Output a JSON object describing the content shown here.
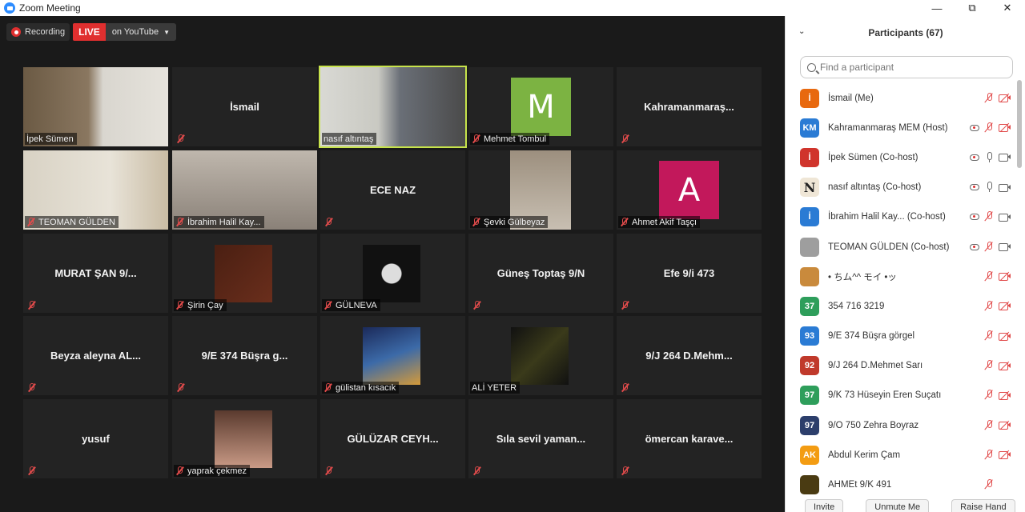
{
  "window": {
    "title": "Zoom Meeting",
    "controls": {
      "minimize": "—",
      "restore": "⧉",
      "close": "✕"
    }
  },
  "recording": {
    "recording_label": "Recording",
    "live_label": "LIVE",
    "stream_label": "on YouTube"
  },
  "tiles": [
    {
      "name": "İpek Sümen",
      "type": "video",
      "label": "İpek Sümen",
      "mic_muted": false
    },
    {
      "name": "İsmail",
      "type": "name",
      "label": "",
      "mic_muted": true
    },
    {
      "name": "nasıf altıntaş",
      "type": "video",
      "label": "nasıf altıntaş",
      "mic_muted": false,
      "speaking": true
    },
    {
      "name": "Mehmet Tombul",
      "type": "avatar",
      "letter": "M",
      "avatar_color": "#7cb342",
      "label": "Mehmet Tombul",
      "mic_muted": true
    },
    {
      "name": "Kahramanmaraş...",
      "type": "name",
      "label": "",
      "mic_muted": true
    },
    {
      "name": "TEOMAN GÜLDEN",
      "type": "video",
      "label": "TEOMAN GÜLDEN",
      "mic_muted": true
    },
    {
      "name": "İbrahim Halil Kay...",
      "type": "video",
      "label": "İbrahim Halil Kay...",
      "mic_muted": true
    },
    {
      "name": "ECE NAZ",
      "type": "name",
      "label": "",
      "mic_muted": true
    },
    {
      "name": "Şevki Gülbeyaz",
      "type": "video",
      "label": "Şevki Gülbeyaz",
      "mic_muted": true
    },
    {
      "name": "Ahmet Akif Taşçı",
      "type": "avatar",
      "letter": "A",
      "avatar_color": "#c2185b",
      "label": "Ahmet Akif Taşçı",
      "mic_muted": true
    },
    {
      "name": "MURAT ŞAN 9/...",
      "type": "name",
      "label": "",
      "mic_muted": true
    },
    {
      "name": "Şirin Çay",
      "type": "photo",
      "label": "Şirin Çay",
      "mic_muted": true
    },
    {
      "name": "GÜLNEVA",
      "type": "photo",
      "label": "GÜLNEVA",
      "mic_muted": true
    },
    {
      "name": "Güneş Toptaş 9/N",
      "type": "name",
      "label": "",
      "mic_muted": true
    },
    {
      "name": "Efe 9/i 473",
      "type": "name",
      "label": "",
      "mic_muted": true
    },
    {
      "name": "Beyza aleyna AL...",
      "type": "name",
      "label": "",
      "mic_muted": true
    },
    {
      "name": "9/E 374 Büşra g...",
      "type": "name",
      "label": "",
      "mic_muted": true
    },
    {
      "name": "gülistan kısacık",
      "type": "photo",
      "label": "gülistan kısacık",
      "mic_muted": true
    },
    {
      "name": "ALİ YETER",
      "type": "photo",
      "label": "ALİ YETER",
      "mic_muted": false
    },
    {
      "name": "9/J 264 D.Mehm...",
      "type": "name",
      "label": "",
      "mic_muted": true
    },
    {
      "name": "yusuf",
      "type": "name",
      "label": "",
      "mic_muted": true
    },
    {
      "name": "yaprak çekmez",
      "type": "photo",
      "label": "yaprak çekmez",
      "mic_muted": true
    },
    {
      "name": "GÜLÜZAR CEYH...",
      "type": "name",
      "label": "",
      "mic_muted": true
    },
    {
      "name": "Sıla sevil yaman...",
      "type": "name",
      "label": "",
      "mic_muted": true
    },
    {
      "name": "ömercan karave...",
      "type": "name",
      "label": "",
      "mic_muted": true
    }
  ],
  "participants_panel": {
    "title": "Participants (67)",
    "search_placeholder": "Find a participant",
    "participants": [
      {
        "name": "İsmail  (Me)",
        "avatar_text": "İ",
        "avatar_color": "#e8690f",
        "recording": false,
        "mic": "off",
        "cam": "off"
      },
      {
        "name": "Kahramanmaraş MEM (Host)",
        "avatar_text": "KM",
        "avatar_color": "#2a7bd4",
        "recording": true,
        "mic": "off",
        "cam": "off"
      },
      {
        "name": "İpek Sümen (Co-host)",
        "avatar_text": "İ",
        "avatar_color": "#d0342c",
        "recording": true,
        "mic": "on",
        "cam": "on"
      },
      {
        "name": "nasıf altıntaş (Co-host)",
        "avatar_text": "N",
        "avatar_color": "#efe6d6",
        "recording": true,
        "mic": "on",
        "cam": "on"
      },
      {
        "name": "İbrahim Halil Kay...  (Co-host)",
        "avatar_text": "İ",
        "avatar_color": "#2a7bd4",
        "recording": true,
        "mic": "off",
        "cam": "on"
      },
      {
        "name": "TEOMAN GÜLDEN (Co-host)",
        "avatar_text": "",
        "avatar_color": "#9e9e9e",
        "recording": true,
        "mic": "off",
        "cam": "on"
      },
      {
        "name": "• ちム^^ モイ •ッ",
        "avatar_text": "",
        "avatar_color": "#c98a3c",
        "recording": false,
        "mic": "off",
        "cam": "off"
      },
      {
        "name": "354 716 3219",
        "avatar_text": "37",
        "avatar_color": "#2e9e5b",
        "recording": false,
        "mic": "off",
        "cam": "off"
      },
      {
        "name": "9/E 374 Büşra görgel",
        "avatar_text": "93",
        "avatar_color": "#2a7bd4",
        "recording": false,
        "mic": "off",
        "cam": "off"
      },
      {
        "name": "9/J 264 D.Mehmet Sarı",
        "avatar_text": "92",
        "avatar_color": "#c0392b",
        "recording": false,
        "mic": "off",
        "cam": "off"
      },
      {
        "name": "9/K 73 Hüseyin Eren Suçatı",
        "avatar_text": "97",
        "avatar_color": "#2e9e5b",
        "recording": false,
        "mic": "off",
        "cam": "off"
      },
      {
        "name": "9/O 750 Zehra Boyraz",
        "avatar_text": "97",
        "avatar_color": "#2c3e6b",
        "recording": false,
        "mic": "off",
        "cam": "off"
      },
      {
        "name": "Abdul Kerim Çam",
        "avatar_text": "AK",
        "avatar_color": "#f39c12",
        "recording": false,
        "mic": "off",
        "cam": "off"
      },
      {
        "name": "AHMEt 9/K 491",
        "avatar_text": "",
        "avatar_color": "#4a3b12",
        "recording": false,
        "mic": "off",
        "cam": "none"
      }
    ],
    "footer": {
      "invite": "Invite",
      "unmute_me": "Unmute Me",
      "raise_hand": "Raise Hand"
    }
  }
}
